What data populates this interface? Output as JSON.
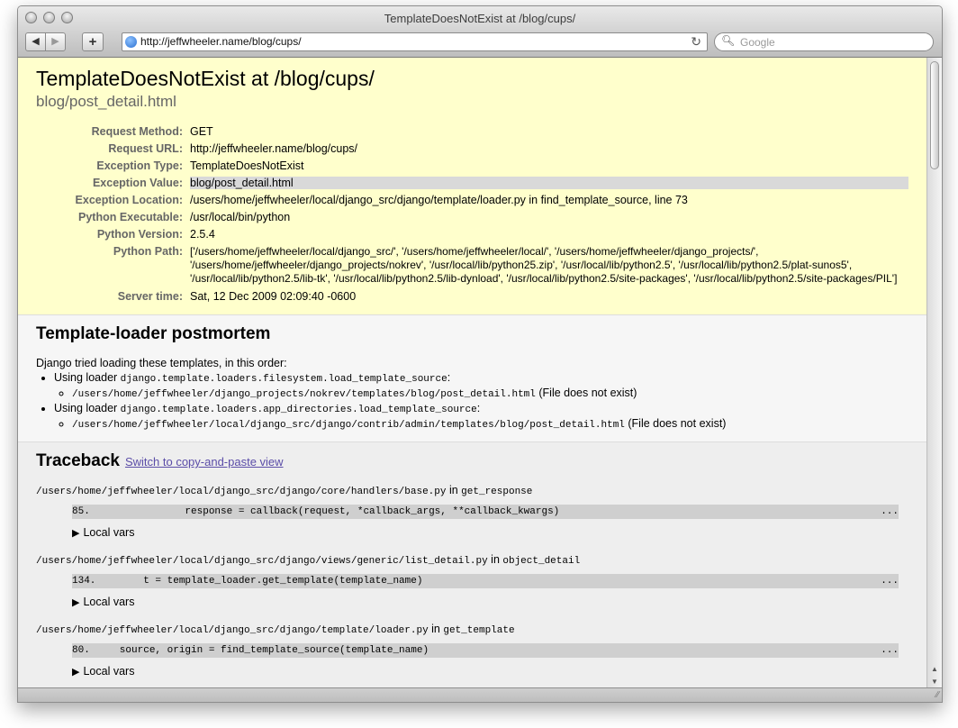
{
  "window": {
    "title": "TemplateDoesNotExist at /blog/cups/",
    "url": "http://jeffwheeler.name/blog/cups/",
    "search_placeholder": "Google",
    "back_icon": "◀",
    "forward_icon": "▶",
    "add_icon": "+",
    "reload_icon": "↻"
  },
  "summary": {
    "heading": "TemplateDoesNotExist at /blog/cups/",
    "subheading": "blog/post_detail.html",
    "rows": [
      {
        "label": "Request Method:",
        "value": "GET"
      },
      {
        "label": "Request URL:",
        "value": "http://jeffwheeler.name/blog/cups/"
      },
      {
        "label": "Exception Type:",
        "value": "TemplateDoesNotExist"
      },
      {
        "label": "Exception Value:",
        "value": "blog/post_detail.html"
      },
      {
        "label": "Exception Location:",
        "value": "/users/home/jeffwheeler/local/django_src/django/template/loader.py in find_template_source, line 73"
      },
      {
        "label": "Python Executable:",
        "value": "/usr/local/bin/python"
      },
      {
        "label": "Python Version:",
        "value": "2.5.4"
      },
      {
        "label": "Python Path:",
        "value": "['/users/home/jeffwheeler/local/django_src/', '/users/home/jeffwheeler/local/', '/users/home/jeffwheeler/django_projects/', '/users/home/jeffwheeler/django_projects/nokrev', '/usr/local/lib/python25.zip', '/usr/local/lib/python2.5', '/usr/local/lib/python2.5/plat-sunos5', '/usr/local/lib/python2.5/lib-tk', '/usr/local/lib/python2.5/lib-dynload', '/usr/local/lib/python2.5/site-packages', '/usr/local/lib/python2.5/site-packages/PIL']"
      },
      {
        "label": "Server time:",
        "value": "Sat, 12 Dec 2009 02:09:40 -0600"
      }
    ]
  },
  "template": {
    "heading": "Template-loader postmortem",
    "intro": "Django tried loading these templates, in this order:",
    "loaders": [
      {
        "prefix": "Using loader ",
        "name": "django.template.loaders.filesystem.load_template_source",
        "suffix": ":",
        "path": "/users/home/jeffwheeler/django_projects/nokrev/templates/blog/post_detail.html",
        "status": " (File does not exist)"
      },
      {
        "prefix": "Using loader ",
        "name": "django.template.loaders.app_directories.load_template_source",
        "suffix": ":",
        "path": "/users/home/jeffwheeler/local/django_src/django/contrib/admin/templates/blog/post_detail.html",
        "status": " (File does not exist)"
      }
    ]
  },
  "traceback": {
    "heading": "Traceback",
    "switch_link": "Switch to copy-and-paste view",
    "frames": [
      {
        "file": "/users/home/jeffwheeler/local/django_src/django/core/handlers/base.py",
        "in": " in ",
        "func": "get_response",
        "line": "85.                response = callback(request, *callback_args, **callback_kwargs)",
        "dots": "...",
        "vars": "Local vars"
      },
      {
        "file": "/users/home/jeffwheeler/local/django_src/django/views/generic/list_detail.py",
        "in": " in ",
        "func": "object_detail",
        "line": "134.        t = template_loader.get_template(template_name)",
        "dots": "...",
        "vars": "Local vars"
      },
      {
        "file": "/users/home/jeffwheeler/local/django_src/django/template/loader.py",
        "in": " in ",
        "func": "get_template",
        "line": "80.     source, origin = find_template_source(template_name)",
        "dots": "...",
        "vars": "Local vars"
      }
    ]
  }
}
